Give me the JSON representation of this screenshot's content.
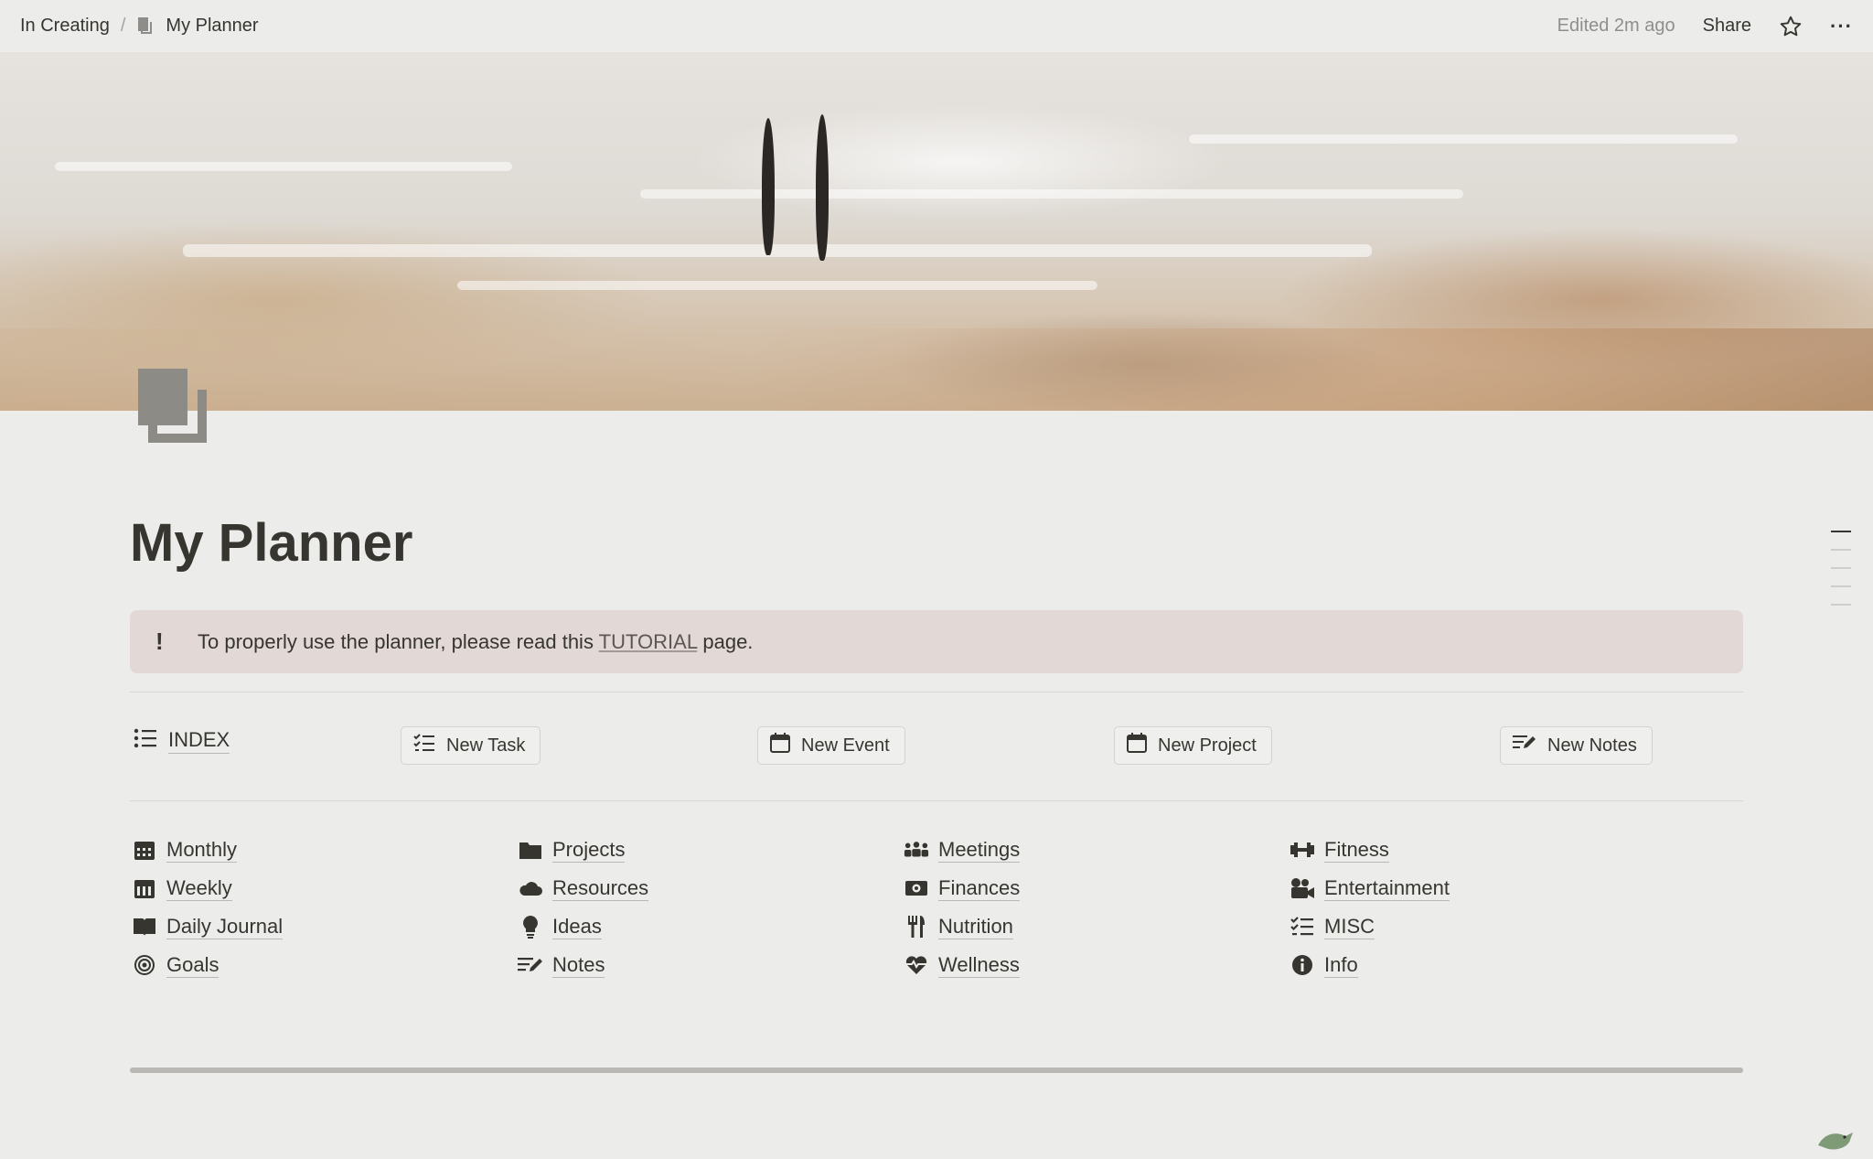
{
  "topbar": {
    "breadcrumb_parent": "In Creating",
    "breadcrumb_separator": "/",
    "breadcrumb_current": "My Planner",
    "edited": "Edited 2m ago",
    "share": "Share",
    "more": "···"
  },
  "page": {
    "title": "My Planner"
  },
  "callout": {
    "icon": "!",
    "text_before": "To properly use the planner, please read this ",
    "link": "TUTORIAL",
    "text_after": " page."
  },
  "index": {
    "label": "INDEX",
    "buttons": {
      "new_task": "New Task",
      "new_event": "New Event",
      "new_project": "New Project",
      "new_notes": "New Notes"
    }
  },
  "links": {
    "col1": [
      "Monthly",
      "Weekly",
      "Daily Journal",
      "Goals"
    ],
    "col2": [
      "Projects",
      "Resources",
      "Ideas",
      "Notes"
    ],
    "col3": [
      "Meetings",
      "Finances",
      "Nutrition",
      "Wellness"
    ],
    "col4": [
      "Fitness",
      "Entertainment",
      "MISC",
      "Info"
    ]
  },
  "colors": {
    "background": "#ececeb",
    "text": "#37352f",
    "callout_bg": "#e2d8d6"
  },
  "icons": {
    "col1": [
      "calendar-icon",
      "calendar-icon",
      "book-icon",
      "target-icon"
    ],
    "col2": [
      "folder-icon",
      "cloud-icon",
      "lightbulb-icon",
      "notes-icon"
    ],
    "col3": [
      "people-icon",
      "money-icon",
      "utensils-icon",
      "heartbeat-icon"
    ],
    "col4": [
      "dumbbell-icon",
      "film-icon",
      "checklist-icon",
      "info-icon"
    ]
  }
}
